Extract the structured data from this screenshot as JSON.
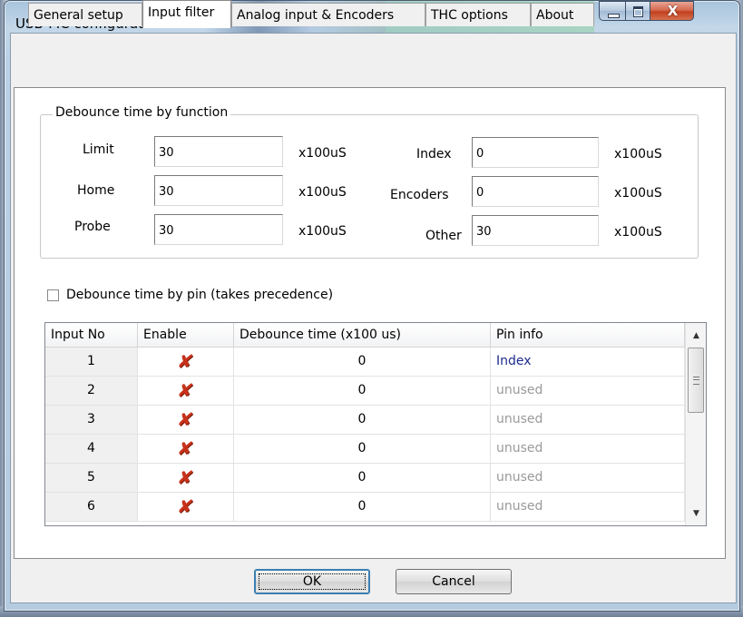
{
  "window": {
    "title": "USB-MC configuration",
    "controls": {
      "minimize": "minimize-icon",
      "maximize": "maximize-icon",
      "close": "close-icon"
    }
  },
  "tabs": [
    {
      "label": "General setup",
      "active": false
    },
    {
      "label": "Input filter",
      "active": true
    },
    {
      "label": "Analog input & Encoders",
      "active": false
    },
    {
      "label": "THC options",
      "active": false
    },
    {
      "label": "About",
      "active": false
    }
  ],
  "debounce_function": {
    "title": "Debounce time by function",
    "unit": "x100uS",
    "fields": [
      {
        "label": "Limit",
        "value": "30"
      },
      {
        "label": "Home",
        "value": "30"
      },
      {
        "label": "Probe",
        "value": "30"
      },
      {
        "label": "Index",
        "value": "0"
      },
      {
        "label": "Encoders",
        "value": "0"
      },
      {
        "label": "Other",
        "value": "30"
      }
    ]
  },
  "debounce_pin": {
    "checkbox_label": "Debounce time by pin (takes precedence)",
    "checked": false,
    "columns": [
      "Input No",
      "Enable",
      "Debounce time (x100 us)",
      "Pin info"
    ],
    "rows": [
      {
        "no": "1",
        "enabled": false,
        "debounce": "0",
        "pin_info": "Index"
      },
      {
        "no": "2",
        "enabled": false,
        "debounce": "0",
        "pin_info": "unused"
      },
      {
        "no": "3",
        "enabled": false,
        "debounce": "0",
        "pin_info": "unused"
      },
      {
        "no": "4",
        "enabled": false,
        "debounce": "0",
        "pin_info": "unused"
      },
      {
        "no": "5",
        "enabled": false,
        "debounce": "0",
        "pin_info": "unused"
      },
      {
        "no": "6",
        "enabled": false,
        "debounce": "0",
        "pin_info": "unused"
      }
    ],
    "disabled_mark": "✘"
  },
  "buttons": {
    "ok": "OK",
    "cancel": "Cancel"
  },
  "colors": {
    "pin_used": "#1c2c8c",
    "pin_unused": "#9a9a9a",
    "disabled_mark": "#c8321b"
  }
}
